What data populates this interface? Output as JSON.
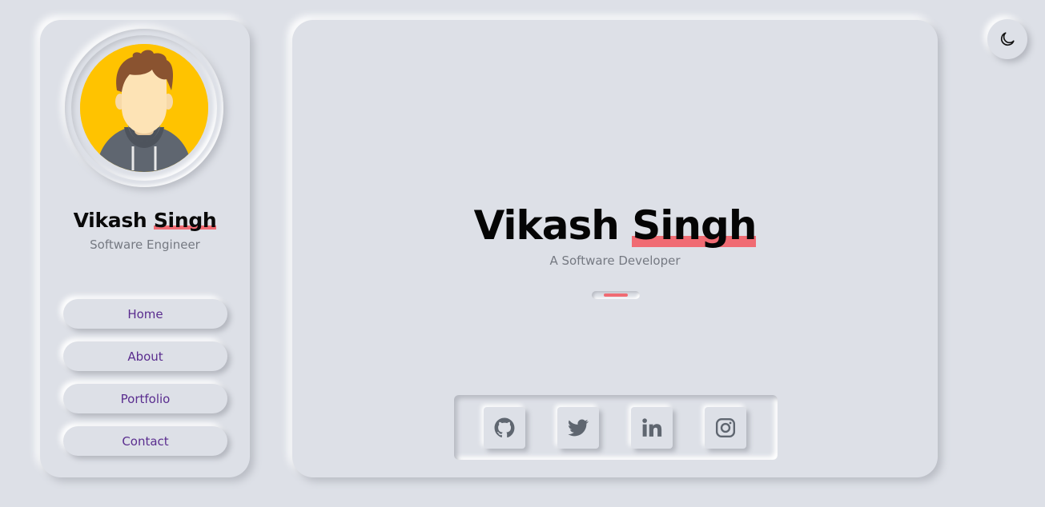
{
  "sidebar": {
    "name_first": "Vikash ",
    "name_last": "Singh",
    "role": "Software Engineer",
    "avatar_icon": "person-avatar",
    "nav": [
      {
        "label": "Home"
      },
      {
        "label": "About"
      },
      {
        "label": "Portfolio"
      },
      {
        "label": "Contact"
      }
    ]
  },
  "hero": {
    "name_first": "Vikash ",
    "name_last": "Singh",
    "subtitle": "A Software Developer"
  },
  "social": [
    {
      "icon": "github-icon"
    },
    {
      "icon": "twitter-icon"
    },
    {
      "icon": "linkedin-icon"
    },
    {
      "icon": "instagram-icon"
    }
  ],
  "theme_toggle": {
    "icon": "moon-icon"
  },
  "colors": {
    "background": "#dde0e7",
    "accent": "#f06b73",
    "nav_text": "#5a2d8f",
    "muted_text": "#757982",
    "icon": "#5f6670"
  }
}
